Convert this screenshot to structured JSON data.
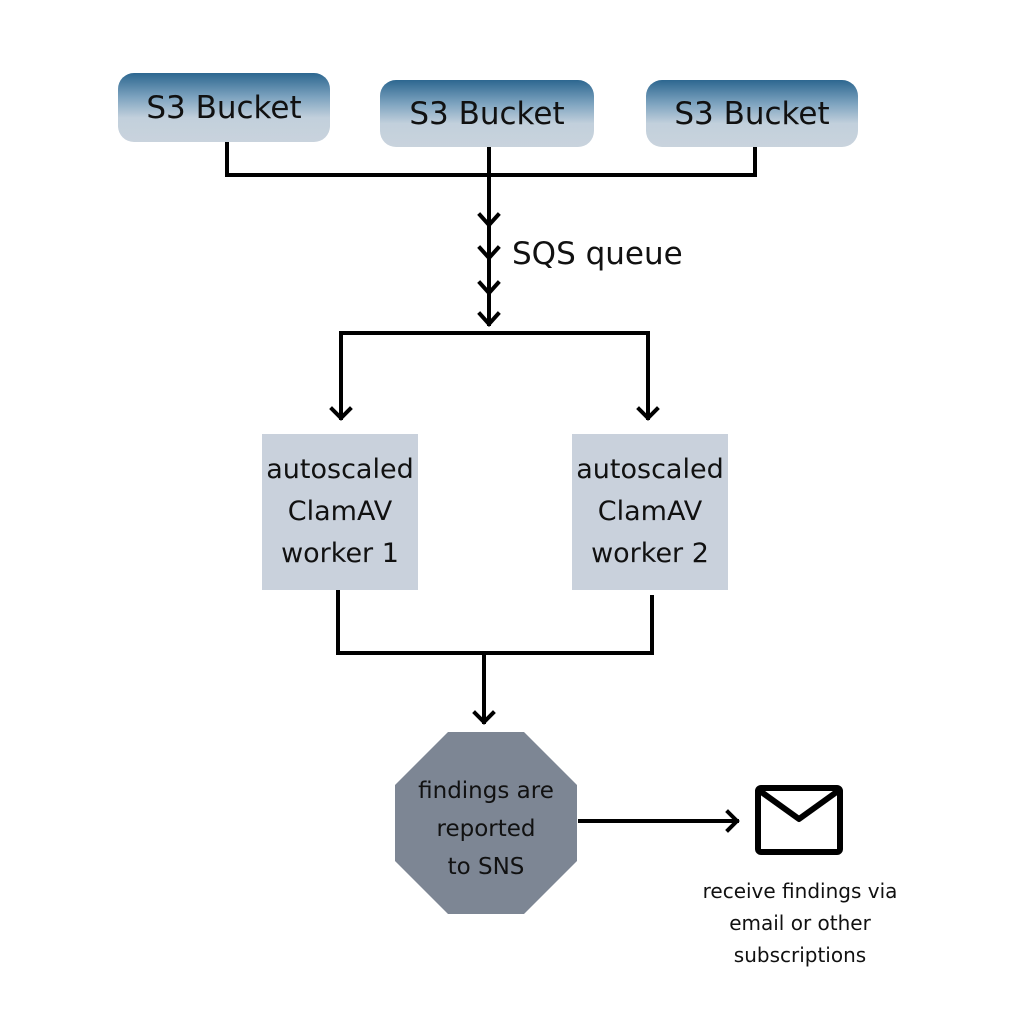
{
  "nodes": {
    "buckets": [
      {
        "label": "S3 Bucket"
      },
      {
        "label": "S3 Bucket"
      },
      {
        "label": "S3 Bucket"
      }
    ],
    "queue_label": "SQS queue",
    "workers": [
      {
        "lines": [
          "autoscaled",
          "ClamAV",
          "worker 1"
        ]
      },
      {
        "lines": [
          "autoscaled",
          "ClamAV",
          "worker 2"
        ]
      }
    ],
    "sns": {
      "lines": [
        "findings are",
        "reported",
        "to SNS"
      ]
    },
    "subscription": {
      "icon": "envelope-icon",
      "lines": [
        "receive findings via",
        "email or other",
        "subscriptions"
      ]
    }
  },
  "colors": {
    "bucket_top": "#2d6790",
    "bucket_bottom": "#c9d3dd",
    "worker_fill": "#c9d1dc",
    "sns_fill": "#7d8694",
    "connector": "#000000"
  }
}
